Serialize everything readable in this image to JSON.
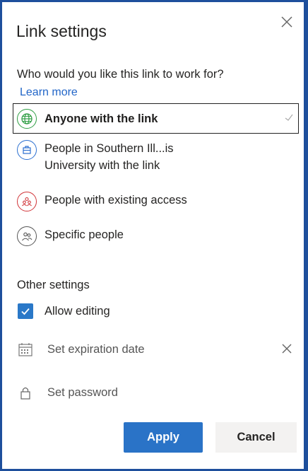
{
  "dialog": {
    "title": "Link settings",
    "question": "Who would you like this link to work for?",
    "learn_more": "Learn more"
  },
  "options": [
    {
      "label": "Anyone with the link",
      "icon": "globe-icon",
      "color": "#2f9e44",
      "selected": true
    },
    {
      "label_line1": "People in Southern Ill...is",
      "label_line2": "University with the link",
      "icon": "organization-icon",
      "color": "#2b6fd0",
      "selected": false
    },
    {
      "label": "People with existing access",
      "icon": "people-group-icon",
      "color": "#d13438",
      "selected": false
    },
    {
      "label": "Specific people",
      "icon": "people-icon",
      "color": "#555555",
      "selected": false
    }
  ],
  "other_settings": {
    "heading": "Other settings",
    "allow_editing": {
      "label": "Allow editing",
      "checked": true
    },
    "expiration": {
      "placeholder": "Set expiration date",
      "icon": "calendar-icon"
    },
    "password": {
      "placeholder": "Set password",
      "icon": "lock-icon"
    }
  },
  "buttons": {
    "apply": "Apply",
    "cancel": "Cancel"
  },
  "colors": {
    "accent": "#2a73c7",
    "border": "#1e4f9c",
    "link": "#2266c8"
  }
}
